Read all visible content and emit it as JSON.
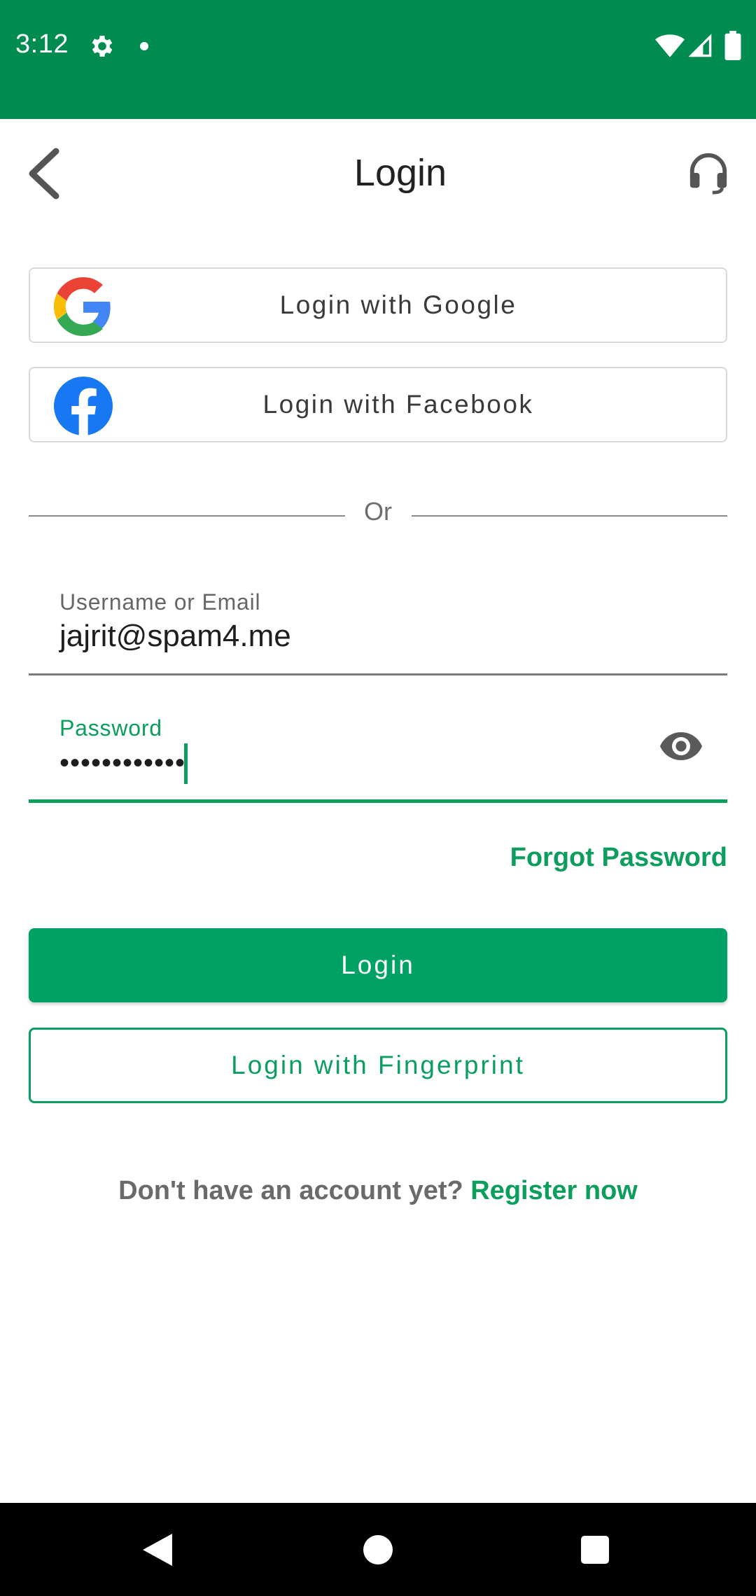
{
  "status_bar": {
    "time": "3:12",
    "icons": [
      "gear-icon",
      "notification-dot",
      "wifi-icon",
      "signal-icon",
      "battery-icon"
    ],
    "background": "#008C50"
  },
  "app_bar": {
    "title": "Login",
    "back_icon": "chevron-left-icon",
    "support_icon": "headset-icon"
  },
  "social": {
    "google_label": "Login with Google",
    "facebook_label": "Login with Facebook"
  },
  "divider": {
    "text": "Or"
  },
  "form": {
    "username_label": "Username or Email",
    "username_value": "jajrit@spam4.me",
    "password_label": "Password",
    "password_value": "••••••••••••",
    "password_toggle_icon": "eye-icon"
  },
  "actions": {
    "forgot_label": "Forgot Password",
    "login_label": "Login",
    "fingerprint_label": "Login with Fingerprint"
  },
  "register": {
    "question": "Don't have an account yet?",
    "link": "Register now"
  },
  "colors": {
    "accent": "#00A164",
    "accent_text": "#0C9E5D",
    "status_bar": "#008C50"
  }
}
